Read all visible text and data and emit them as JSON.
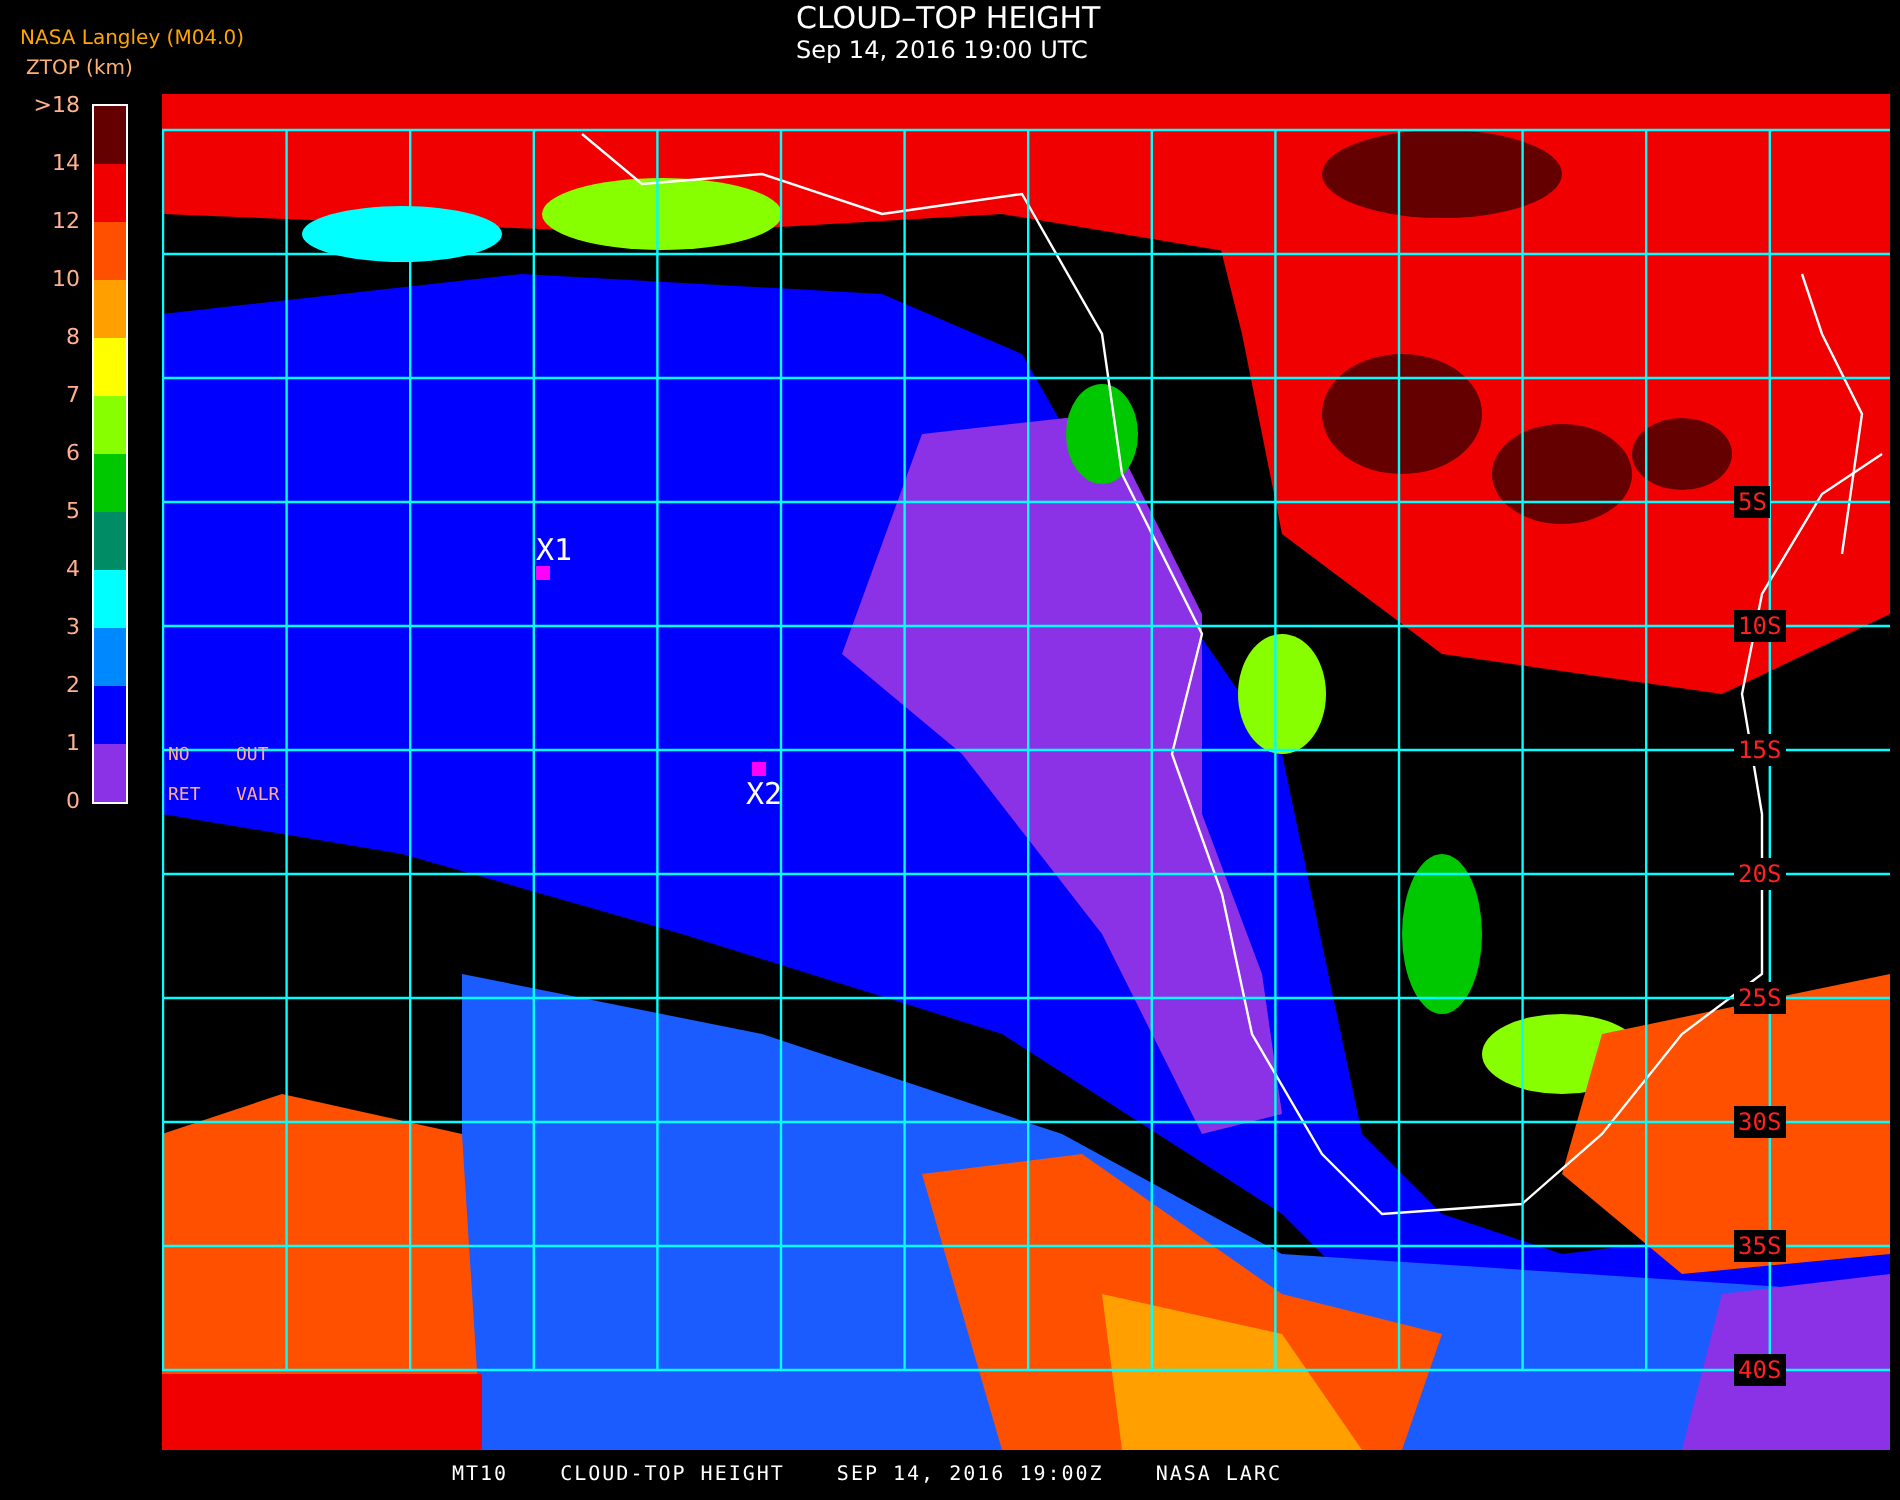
{
  "header": {
    "title": "CLOUD–TOP HEIGHT",
    "timestamp": "Sep 14, 2016 19:00 UTC"
  },
  "legend": {
    "source": "NASA Langley (M04.0)",
    "unit_label": "ZTOP (km)",
    "ticks": [
      ">18",
      "14",
      "12",
      "10",
      "8",
      "7",
      "6",
      "5",
      "4",
      "3",
      "2",
      "1",
      "0"
    ],
    "bands": [
      {
        "color": "#640000"
      },
      {
        "color": "#f00000"
      },
      {
        "color": "#ff5000"
      },
      {
        "color": "#ffa000"
      },
      {
        "color": "#ffff00"
      },
      {
        "color": "#88ff00"
      },
      {
        "color": "#00c800"
      },
      {
        "color": "#008c64"
      },
      {
        "color": "#00ffff"
      },
      {
        "color": "#0088ff"
      },
      {
        "color": "#0000ff"
      },
      {
        "color": "#8c32e6"
      }
    ]
  },
  "map": {
    "notes": [
      "NO",
      "OUT",
      "RET",
      "VALR"
    ],
    "latitude_labels": [
      "5S",
      "10S",
      "15S",
      "20S",
      "25S",
      "30S",
      "35S",
      "40S"
    ],
    "markers": [
      {
        "label": "X1"
      },
      {
        "label": "X2"
      }
    ]
  },
  "footer": [
    "MT10",
    "CLOUD-TOP HEIGHT",
    "SEP 14, 2016 19:00Z",
    "NASA LARC"
  ]
}
